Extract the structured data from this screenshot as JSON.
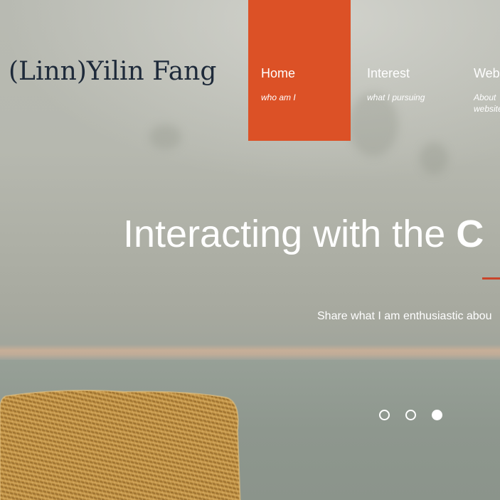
{
  "brand": {
    "name": "(Linn)Yilin Fang"
  },
  "nav": {
    "items": [
      {
        "title": "Home",
        "subtitle": "who am I",
        "active": true
      },
      {
        "title": "Interest",
        "subtitle": "what I pursuing",
        "active": false
      },
      {
        "title": "Web",
        "subtitle": "About website",
        "active": false
      }
    ],
    "accent_color": "#dc5126"
  },
  "hero": {
    "headline_light": "Interacting with the",
    "headline_bold": "C",
    "tagline": "Share what I am enthusiastic abou",
    "slides": {
      "count": 3,
      "active_index": 2
    }
  }
}
